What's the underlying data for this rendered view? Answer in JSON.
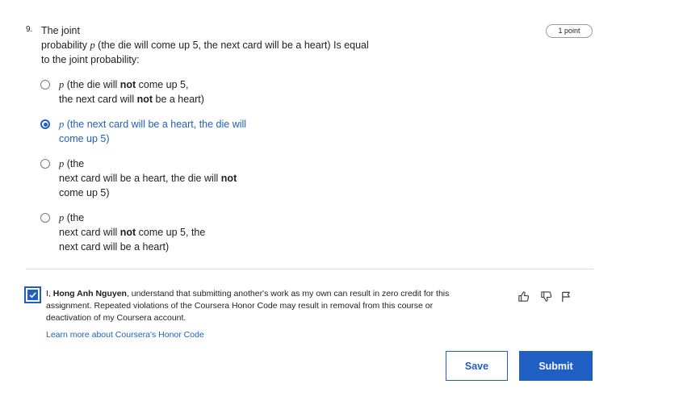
{
  "question": {
    "number": "9.",
    "points": "1 point",
    "text_line1": "The joint",
    "text_line2_pre": "probability ",
    "p": "p",
    "text_line2_post": " (the die will come up 5, the next card will be a heart) Is equal",
    "text_line3": "to the joint probability:"
  },
  "options": [
    {
      "selected": false,
      "p": "p",
      "parts": [
        " (the die will ",
        "not",
        " come up 5,"
      ],
      "line2": [
        "the next card will ",
        "not",
        " be a heart)"
      ]
    },
    {
      "selected": true,
      "p": "p",
      "line1": " (the next card will be a heart, the die will",
      "line2": "come up 5)"
    },
    {
      "selected": false,
      "p": "p",
      "line1": " (the",
      "line2": [
        "next card will be a heart, the die will ",
        "not"
      ],
      "line3": "come up 5)"
    },
    {
      "selected": false,
      "p": "p",
      "line1": " (the",
      "line2": [
        "next card will ",
        "not",
        " come up 5, the"
      ],
      "line3": "next card will be a heart)"
    }
  ],
  "honor": {
    "prefix": "I, ",
    "name": "Hong Anh Nguyen",
    "text": ", understand that submitting another's work as my own can result in zero credit for this assignment. Repeated violations of the Coursera Honor Code may result in removal from this course or deactivation of my Coursera account.",
    "link": "Learn more about Coursera's Honor Code",
    "checked": true
  },
  "buttons": {
    "save": "Save",
    "submit": "Submit"
  },
  "colors": {
    "accent": "#1f5fc4",
    "divider": "#d9d9d9"
  },
  "icons": [
    "thumbs-up-icon",
    "thumbs-down-icon",
    "flag-icon"
  ]
}
